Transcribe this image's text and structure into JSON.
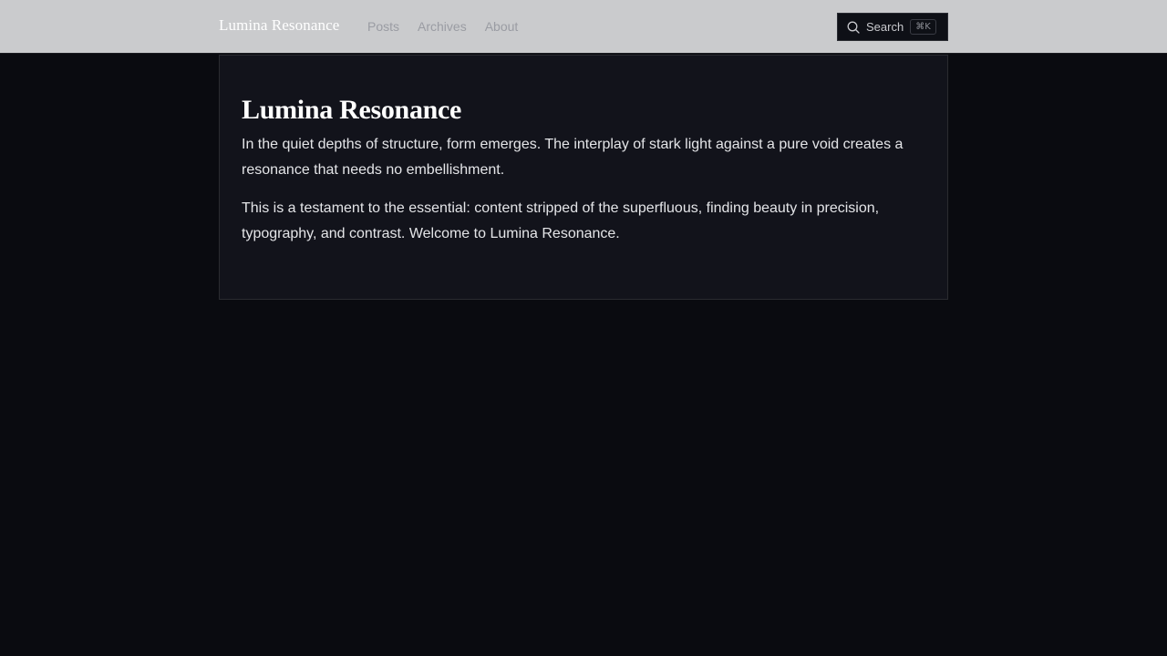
{
  "header": {
    "brand": "Lumina Resonance",
    "nav": [
      {
        "label": "Posts"
      },
      {
        "label": "Archives"
      },
      {
        "label": "About"
      }
    ],
    "search": {
      "label": "Search",
      "shortcut": "⌘K",
      "icon": "search-icon"
    }
  },
  "main": {
    "title": "Lumina Resonance",
    "paragraphs": [
      "In the quiet depths of structure, form emerges. The interplay of stark light against a pure void creates a resonance that needs no embellishment.",
      "This is a testament to the essential: content stripped of the superfluous, finding beauty in precision, typography, and contrast. Welcome to Lumina Resonance."
    ]
  },
  "colors": {
    "page_background": "#0a0b10",
    "header_background": "#cacbcd",
    "card_background": "#12131b",
    "text": "#e4e5e8",
    "nav_text": "#9a9ca3"
  }
}
